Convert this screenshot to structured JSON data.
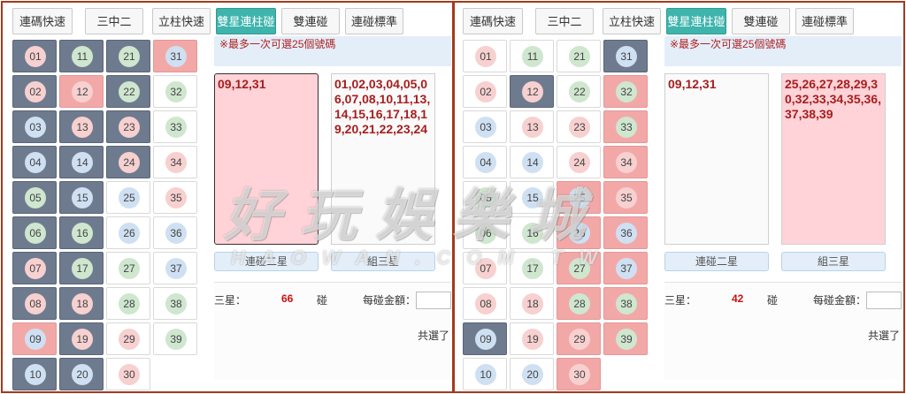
{
  "tabs": [
    "連碼快速",
    "三中二",
    "立柱快速",
    "雙星連柱碰",
    "雙連碰",
    "連碰標準"
  ],
  "active_tab_index": 3,
  "hint": "※最多一次可選25個號碼",
  "left": {
    "selected_text": "09,12,31",
    "pool_text": "01,02,03,04,05,06,07,08,10,11,13,14,15,16,17,18,19,20,21,22,23,24",
    "button1": "連碰二星",
    "button2": "組三星",
    "star_label": "三星：",
    "star_count": "66",
    "peng_label": "碰",
    "money_label": "每碰金額：",
    "total_label": "共選了"
  },
  "right": {
    "selected_text": "09,12,31",
    "pool_text": "25,26,27,28,29,30,32,33,34,35,36,37,38,39",
    "button1": "連碰二星",
    "button2": "組三星",
    "star_label": "三星：",
    "star_count": "42",
    "peng_label": "碰",
    "money_label": "每碰金額：",
    "total_label": "共選了"
  },
  "numbers": [
    "01",
    "02",
    "03",
    "04",
    "05",
    "06",
    "07",
    "08",
    "09",
    "10",
    "11",
    "12",
    "13",
    "14",
    "15",
    "16",
    "17",
    "18",
    "19",
    "20",
    "21",
    "22",
    "23",
    "24",
    "25",
    "26",
    "27",
    "28",
    "29",
    "30",
    "31",
    "32",
    "33",
    "34",
    "35",
    "36",
    "37",
    "38",
    "39"
  ],
  "ball_colors": {
    "01": "r",
    "02": "r",
    "07": "r",
    "08": "r",
    "12": "r",
    "13": "r",
    "18": "r",
    "19": "r",
    "23": "r",
    "24": "r",
    "29": "r",
    "30": "r",
    "34": "r",
    "35": "r",
    "03": "b",
    "04": "b",
    "09": "b",
    "10": "b",
    "14": "b",
    "15": "b",
    "20": "b",
    "25": "b",
    "26": "b",
    "31": "b",
    "36": "b",
    "37": "b",
    "05": "g",
    "06": "g",
    "11": "g",
    "16": "g",
    "17": "g",
    "21": "g",
    "22": "g",
    "27": "g",
    "28": "g",
    "32": "g",
    "33": "g",
    "38": "g",
    "39": "g"
  },
  "left_states": {
    "01": "dark",
    "02": "dark",
    "03": "dark",
    "04": "dark",
    "05": "dark",
    "06": "dark",
    "07": "dark",
    "08": "dark",
    "09": "pink",
    "10": "dark",
    "11": "dark",
    "12": "pink",
    "13": "dark",
    "14": "dark",
    "15": "dark",
    "16": "dark",
    "17": "dark",
    "18": "dark",
    "19": "dark",
    "20": "dark",
    "21": "dark",
    "22": "dark",
    "23": "dark",
    "24": "dark",
    "31": "pink"
  },
  "right_states": {
    "09": "dark",
    "12": "dark",
    "31": "dark",
    "25": "pink",
    "26": "pink",
    "27": "pink",
    "28": "pink",
    "29": "pink",
    "30": "pink",
    "32": "pink",
    "33": "pink",
    "34": "pink",
    "35": "pink",
    "36": "pink",
    "37": "pink",
    "38": "pink",
    "39": "pink"
  },
  "watermark": "好玩娛樂城",
  "watermark_sub": "HAOWAN.COM.TW"
}
